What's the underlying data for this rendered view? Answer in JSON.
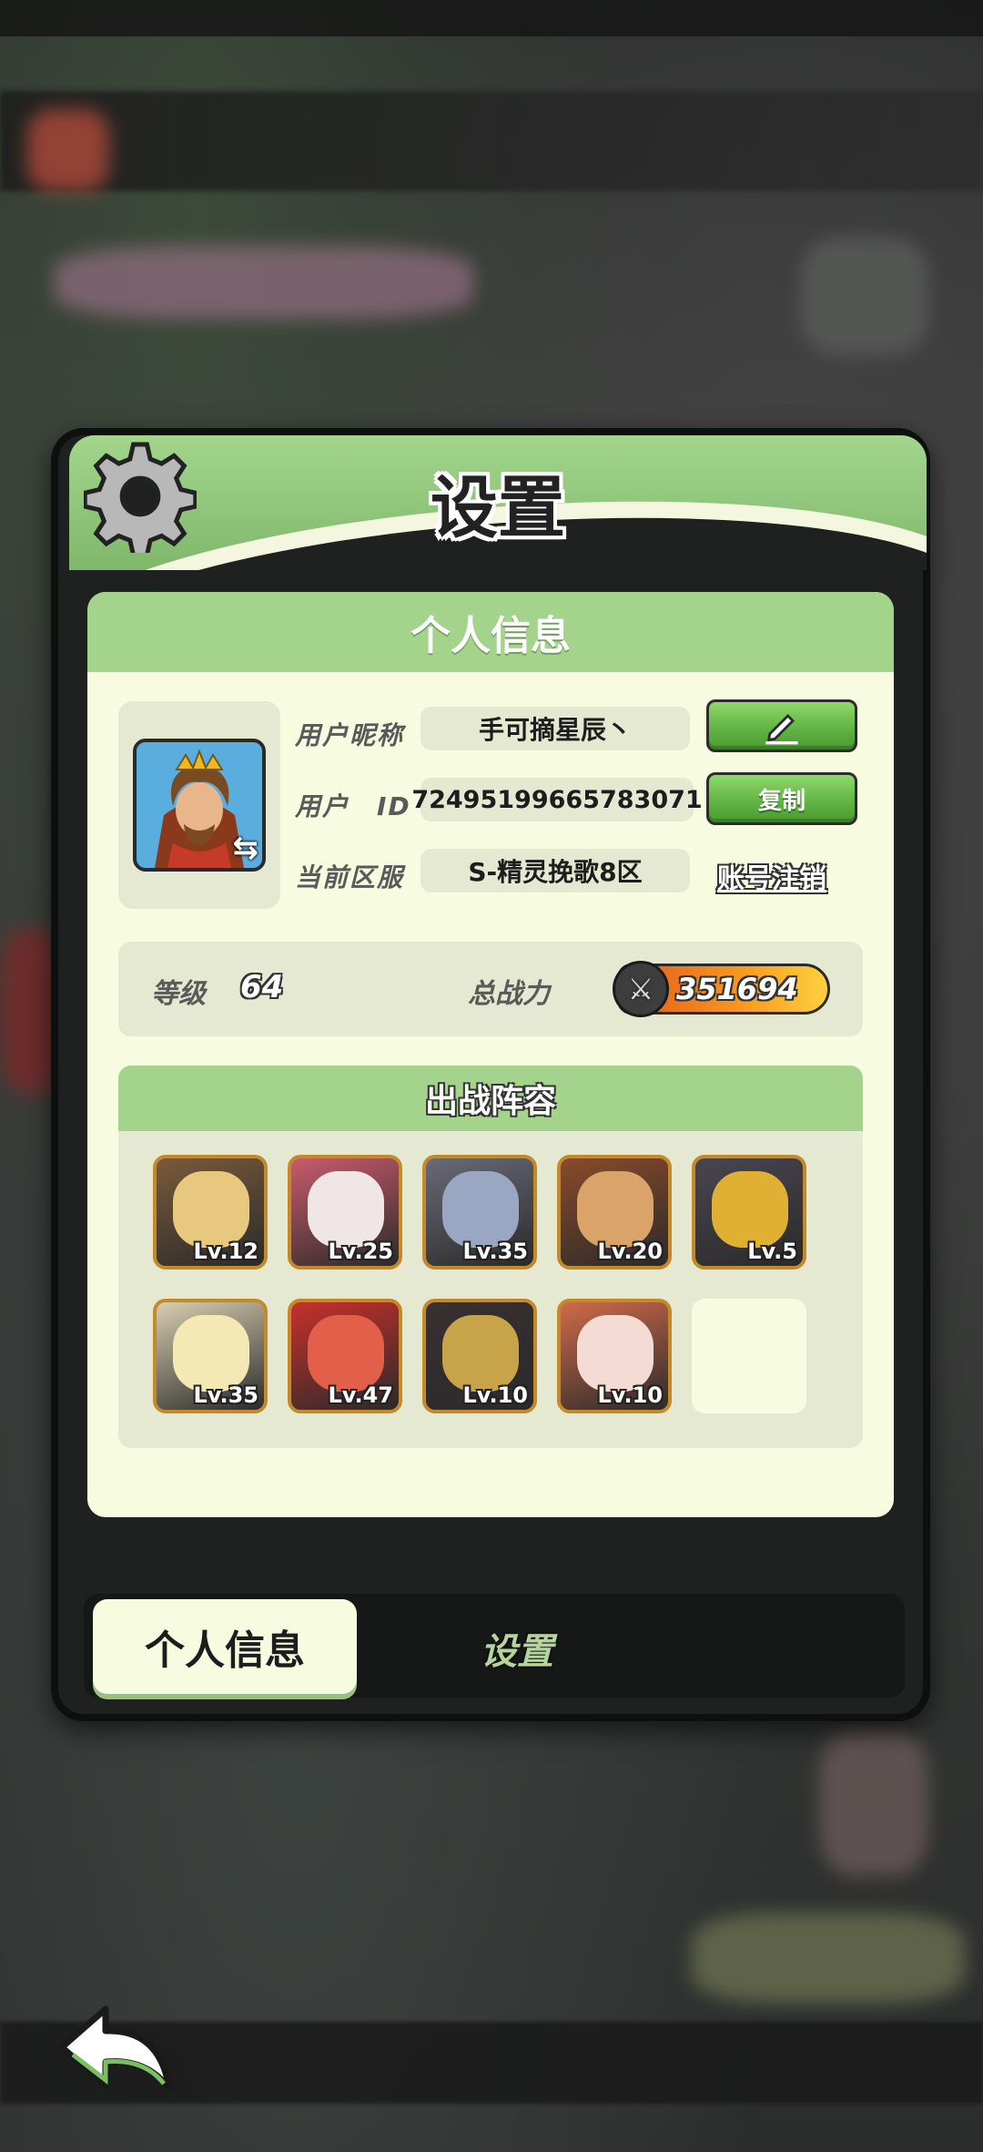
{
  "dialog": {
    "title": "设置"
  },
  "info_card": {
    "heading": "个人信息",
    "nickname_label": "用户昵称",
    "nickname_value": "手可摘星辰丶",
    "userid_label": "用户　ID",
    "userid_value": "72495199665783071",
    "server_label": "当前区服",
    "server_value": "S-精灵挽歌8区",
    "copy_button": "复制",
    "logout_link": "账号注销",
    "level_label": "等级",
    "level_value": "64",
    "power_label": "总战力",
    "power_value": "351694"
  },
  "lineup": {
    "heading": "出战阵容",
    "heroes": [
      {
        "level": "Lv.12",
        "color": "#7a5a3a",
        "face": "#e8c77e"
      },
      {
        "level": "Lv.25",
        "color": "#c95b6b",
        "face": "#f0e6e6"
      },
      {
        "level": "Lv.35",
        "color": "#6a6a78",
        "face": "#9aa7c2"
      },
      {
        "level": "Lv.20",
        "color": "#8a4a2a",
        "face": "#d9a36a"
      },
      {
        "level": "Lv.5",
        "color": "#4a4550",
        "face": "#e0b032"
      },
      {
        "level": "Lv.35",
        "color": "#d8cdb0",
        "face": "#f4e8b4"
      },
      {
        "level": "Lv.47",
        "color": "#c8302a",
        "face": "#e2604a"
      },
      {
        "level": "Lv.10",
        "color": "#3a3030",
        "face": "#c7a44a"
      },
      {
        "level": "Lv.10",
        "color": "#d06a4a",
        "face": "#f4dcd4"
      }
    ]
  },
  "tabs": {
    "info": "个人信息",
    "settings": "设置"
  }
}
